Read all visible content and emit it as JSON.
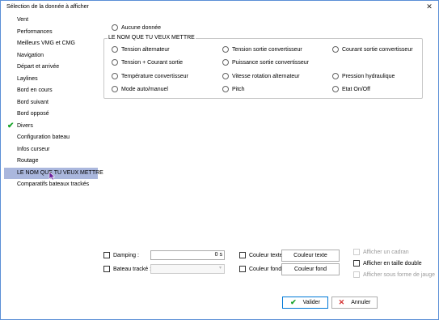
{
  "window": {
    "title": "Sélection de la donnée à afficher",
    "close_glyph": "✕"
  },
  "sidebar": {
    "items": [
      {
        "label": "Vent"
      },
      {
        "label": "Performances"
      },
      {
        "label": "Meilleurs VMG et CMG"
      },
      {
        "label": "Navigation"
      },
      {
        "label": "Départ et arrivée"
      },
      {
        "label": "Laylines"
      },
      {
        "label": "Bord en cours"
      },
      {
        "label": "Bord suivant"
      },
      {
        "label": "Bord opposé"
      },
      {
        "label": "Divers",
        "checked": true
      },
      {
        "label": "Configuration bateau"
      },
      {
        "label": "Infos curseur"
      },
      {
        "label": "Routage"
      },
      {
        "label": "LE NOM QUE TU VEUX METTRE",
        "selected": true
      },
      {
        "label": "Comparatifs bateaux trackés"
      }
    ],
    "check_glyph": "✔"
  },
  "no_data_option": "Aucune donnée",
  "group": {
    "title": "LE NOM QUE TU VEUX METTRE",
    "options": [
      "Tension alternateur",
      "Tension sortie convertisseur",
      "Courant sortie convertisseur",
      "Tension + Courant sortie",
      "Puissance sortie convertisseur",
      "Température convertisseur",
      "Vitesse rotation alternateur",
      "Pression hydraulique",
      "Mode auto/manuel",
      "Pitch",
      "Etat On/Off"
    ]
  },
  "bottom": {
    "damping_label": "Damping :",
    "damping_value": "0 s",
    "tracked_boat_label": "Bateau tracké :",
    "tracked_boat_value": "",
    "text_color_label": "Couleur texte :",
    "text_color_button": "Couleur texte",
    "bg_color_label": "Couleur fond :",
    "bg_color_button": "Couleur fond",
    "show_dial": "Afficher un cadran",
    "show_double_size": "Afficher en taille double",
    "show_gauge": "Afficher sous forme de jauge"
  },
  "buttons": {
    "ok": "Valider",
    "cancel": "Annuler"
  },
  "colors": {
    "selection": "#aab7dd",
    "check": "#17a328",
    "cancel_x": "#d32f2f",
    "accent_border": "#0078d7"
  }
}
